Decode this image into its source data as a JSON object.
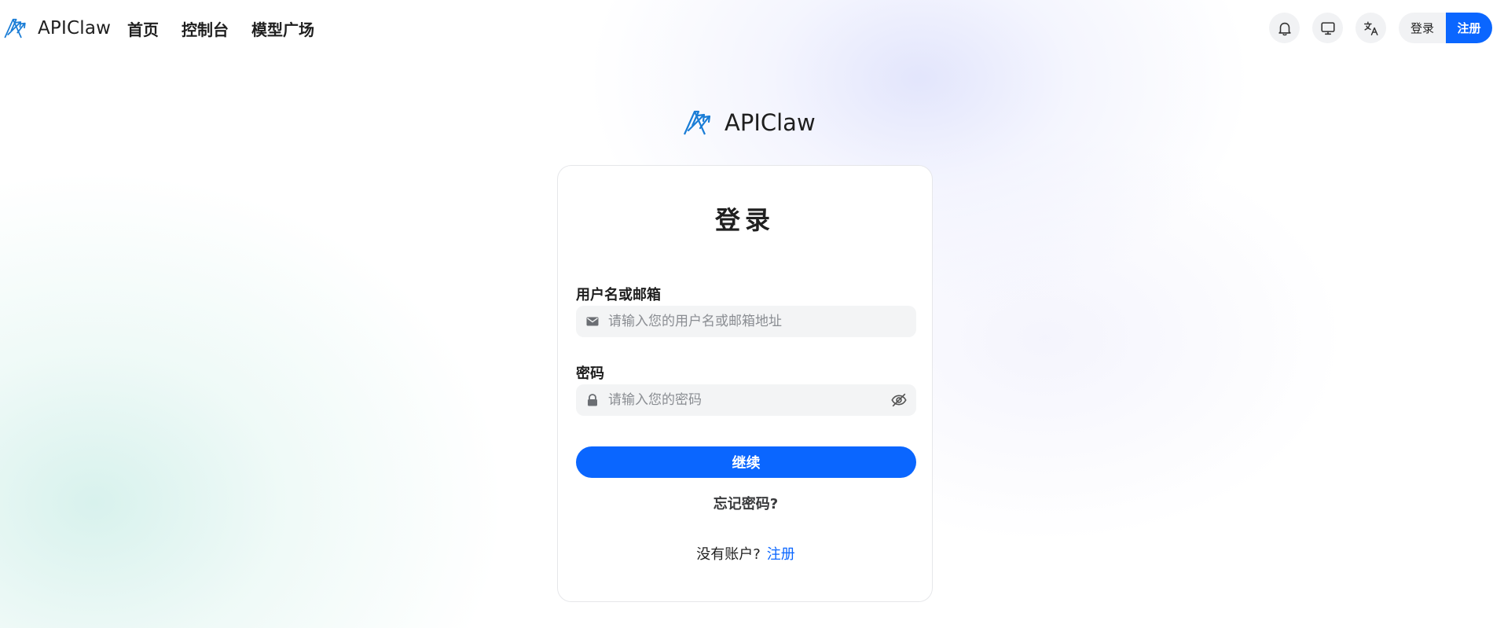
{
  "header": {
    "brand_name": "APIClaw",
    "nav": [
      {
        "label": "首页"
      },
      {
        "label": "控制台"
      },
      {
        "label": "模型广场"
      }
    ],
    "icons": [
      "bell-icon",
      "monitor-icon",
      "translate-icon"
    ],
    "login_label": "登录",
    "register_label": "注册"
  },
  "center_brand": {
    "name": "APIClaw"
  },
  "login_card": {
    "title": "登录",
    "username_label": "用户名或邮箱",
    "username_placeholder": "请输入您的用户名或邮箱地址",
    "password_label": "密码",
    "password_placeholder": "请输入您的密码",
    "continue_label": "继续",
    "forgot_label": "忘记密码?",
    "no_account_text": "没有账户?",
    "signup_label": "注册"
  },
  "colors": {
    "accent": "#0a66ff",
    "text": "#1f1f1f",
    "field_bg": "#f3f4f5",
    "icon_btn_bg": "#f1f2f4"
  }
}
